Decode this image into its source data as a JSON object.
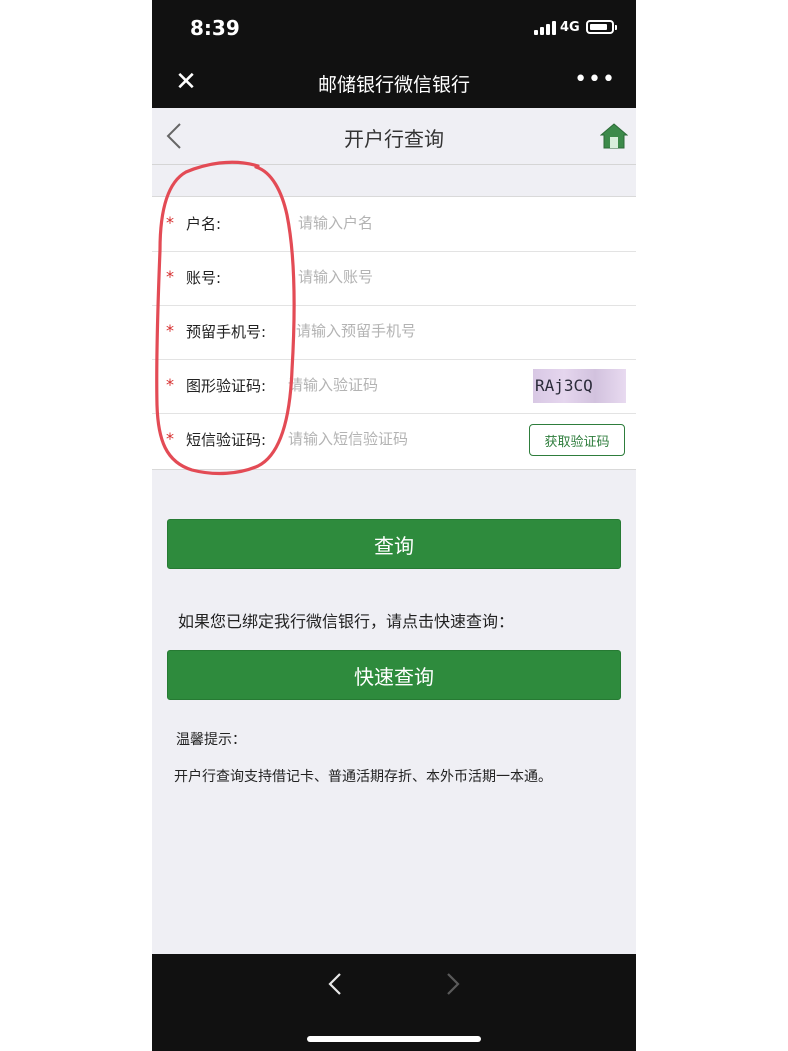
{
  "status_bar": {
    "time": "8:39",
    "network": "4G"
  },
  "nav": {
    "title": "邮储银行微信银行",
    "close_icon": "close-icon",
    "more_icon": "more-dots-icon"
  },
  "header": {
    "title": "开户行查询",
    "back_icon": "chevron-left-icon",
    "home_icon": "home-icon"
  },
  "form": {
    "required_mark": "*",
    "fields": [
      {
        "label": "户名:",
        "placeholder": "请输入户名",
        "value": ""
      },
      {
        "label": "账号:",
        "placeholder": "请输入账号",
        "value": ""
      },
      {
        "label": "预留手机号:",
        "placeholder": "请输入预留手机号",
        "value": ""
      },
      {
        "label": "图形验证码:",
        "placeholder": "请输入验证码",
        "value": ""
      },
      {
        "label": "短信验证码:",
        "placeholder": "请输入短信验证码",
        "value": ""
      }
    ],
    "captcha_text": "RAj3CQ",
    "sms_button_label": "获取验证码"
  },
  "actions": {
    "query_label": "查询",
    "bind_tip": "如果您已绑定我行微信银行，请点击快速查询：",
    "fast_query_label": "快速查询"
  },
  "tips": {
    "title": "温馨提示：",
    "text": "开户行查询支持借记卡、普通活期存折、本外币活期一本通。"
  },
  "bottom_bar": {
    "back_icon": "chevron-left-icon",
    "forward_icon": "chevron-right-icon"
  },
  "colors": {
    "brand_green": "#2e8b3d",
    "required_red": "#d62b2b",
    "annotation_red": "#e34b55",
    "dark_bar": "#111111"
  }
}
